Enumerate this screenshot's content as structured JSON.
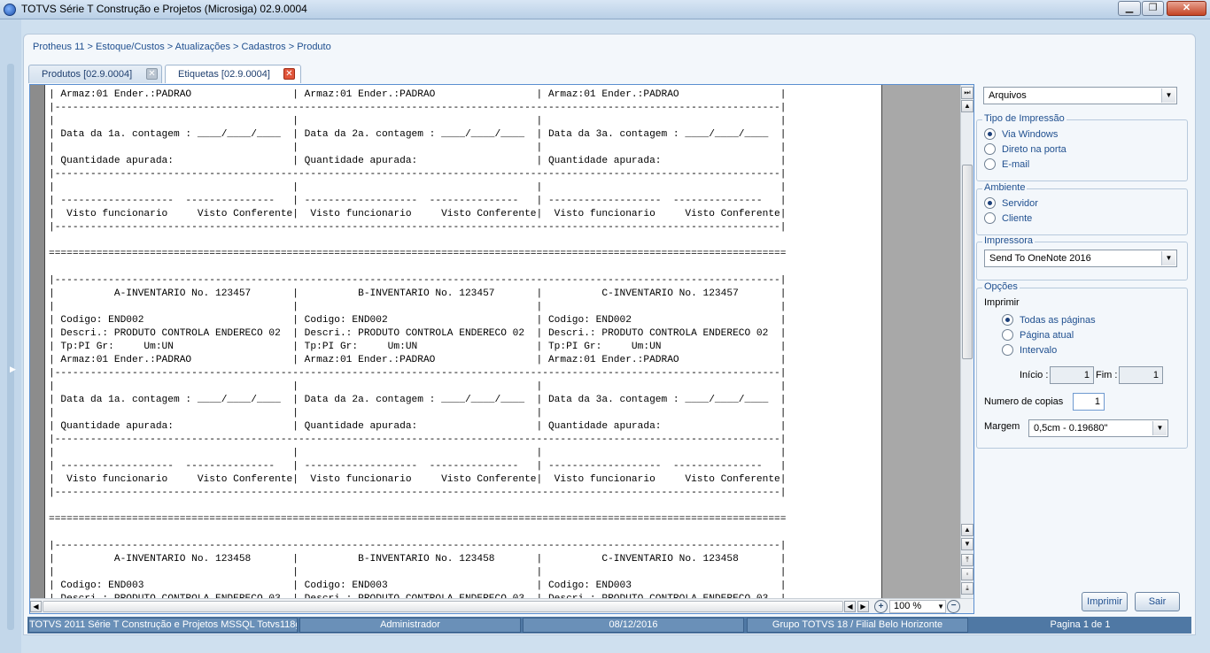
{
  "window": {
    "title": "TOTVS Série T Construção e Projetos (Microsiga) 02.9.0004"
  },
  "breadcrumb": "Protheus 11 > Estoque/Custos > Atualizações > Cadastros > Produto",
  "tabs": [
    {
      "label": "Produtos [02.9.0004]"
    },
    {
      "label": "Etiquetas [02.9.0004]"
    }
  ],
  "report": {
    "lines": [
      "| Armaz:01 Ender.:PADRAO                 | Armaz:01 Ender.:PADRAO                 | Armaz:01 Ender.:PADRAO                 |",
      "|--------------------------------------------------------------------------------------------------------------------------|",
      "|                                        |                                        |                                        |",
      "| Data da 1a. contagem : ____/____/____  | Data da 2a. contagem : ____/____/____  | Data da 3a. contagem : ____/____/____  |",
      "|                                        |                                        |                                        |",
      "| Quantidade apurada:                    | Quantidade apurada:                    | Quantidade apurada:                    |",
      "|--------------------------------------------------------------------------------------------------------------------------|",
      "|                                        |                                        |                                        |",
      "| -------------------  ---------------   | -------------------  ---------------   | -------------------  ---------------   |",
      "|  Visto funcionario     Visto Conferente|  Visto funcionario     Visto Conferente|  Visto funcionario     Visto Conferente|",
      "|--------------------------------------------------------------------------------------------------------------------------|",
      "",
      "============================================================================================================================",
      "",
      "|--------------------------------------------------------------------------------------------------------------------------|",
      "|          A-INVENTARIO No. 123457       |          B-INVENTARIO No. 123457       |          C-INVENTARIO No. 123457       |",
      "|                                        |                                        |                                        |",
      "| Codigo: END002                         | Codigo: END002                         | Codigo: END002                         |",
      "| Descri.: PRODUTO CONTROLA ENDERECO 02  | Descri.: PRODUTO CONTROLA ENDERECO 02  | Descri.: PRODUTO CONTROLA ENDERECO 02  |",
      "| Tp:PI Gr:     Um:UN                    | Tp:PI Gr:     Um:UN                    | Tp:PI Gr:     Um:UN                    |",
      "| Armaz:01 Ender.:PADRAO                 | Armaz:01 Ender.:PADRAO                 | Armaz:01 Ender.:PADRAO                 |",
      "|--------------------------------------------------------------------------------------------------------------------------|",
      "|                                        |                                        |                                        |",
      "| Data da 1a. contagem : ____/____/____  | Data da 2a. contagem : ____/____/____  | Data da 3a. contagem : ____/____/____  |",
      "|                                        |                                        |                                        |",
      "| Quantidade apurada:                    | Quantidade apurada:                    | Quantidade apurada:                    |",
      "|--------------------------------------------------------------------------------------------------------------------------|",
      "|                                        |                                        |                                        |",
      "| -------------------  ---------------   | -------------------  ---------------   | -------------------  ---------------   |",
      "|  Visto funcionario     Visto Conferente|  Visto funcionario     Visto Conferente|  Visto funcionario     Visto Conferente|",
      "|--------------------------------------------------------------------------------------------------------------------------|",
      "",
      "============================================================================================================================",
      "",
      "|--------------------------------------------------------------------------------------------------------------------------|",
      "|          A-INVENTARIO No. 123458       |          B-INVENTARIO No. 123458       |          C-INVENTARIO No. 123458       |",
      "|                                        |                                        |                                        |",
      "| Codigo: END003                         | Codigo: END003                         | Codigo: END003                         |",
      "| Descri.: PRODUTO CONTROLA ENDERECO 03  | Descri.: PRODUTO CONTROLA ENDERECO 03  | Descri.: PRODUTO CONTROLA ENDERECO 03  |"
    ]
  },
  "zoom": {
    "value": "100 %"
  },
  "right_panel": {
    "output_select": "Arquivos",
    "tipo_impressao": {
      "legend": "Tipo de Impressão",
      "options": [
        "Via Windows",
        "Direto na porta",
        "E-mail"
      ],
      "selected": "Via Windows"
    },
    "ambiente": {
      "legend": "Ambiente",
      "options": [
        "Servidor",
        "Cliente"
      ],
      "selected": "Servidor"
    },
    "impressora": {
      "legend": "Impressora",
      "value": "Send To OneNote 2016"
    },
    "opcoes": {
      "legend": "Opções",
      "imprimir_label": "Imprimir",
      "options": [
        "Todas as páginas",
        "Página atual",
        "Intervalo"
      ],
      "selected": "Todas as páginas",
      "inicio_label": "Início :",
      "inicio_value": "1",
      "fim_label": "Fim :",
      "fim_value": "1",
      "copias_label": "Numero de copias",
      "copias_value": "1",
      "margem_label": "Margem",
      "margem_value": "0,5cm - 0.19680\""
    },
    "buttons": {
      "print": "Imprimir",
      "exit": "Sair"
    }
  },
  "status_bar": {
    "system": "TOTVS 2011 Série T Construção e Projetos MSSQL Totvs118g",
    "user": "Administrador",
    "date": "08/12/2016",
    "company": "Grupo TOTVS 18 / Filial Belo Horizonte",
    "page": "Pagina 1 de 1"
  }
}
